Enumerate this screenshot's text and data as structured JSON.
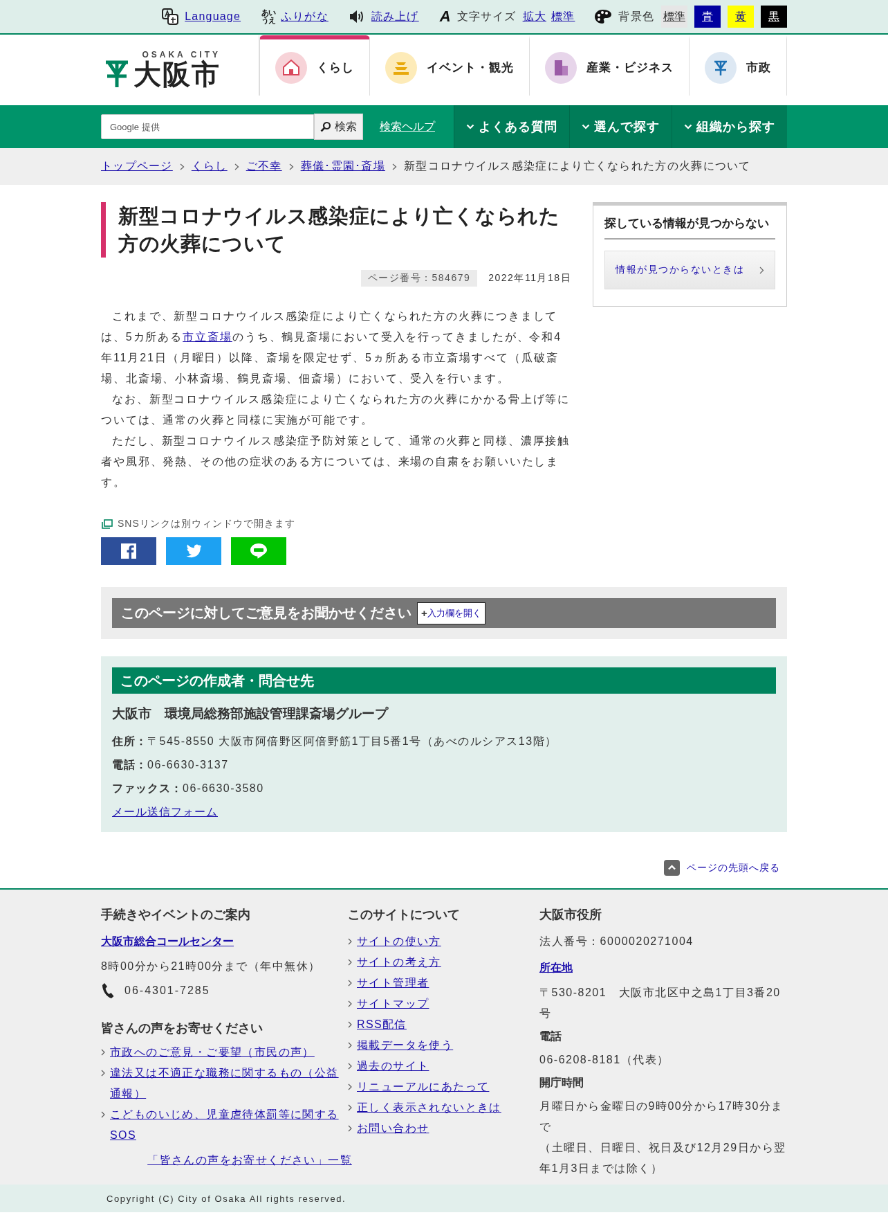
{
  "top_bar": {
    "language": "Language",
    "furigana_glyph": [
      "あい",
      "うえ"
    ],
    "furigana": "ふりがな",
    "read_aloud": "読み上げ",
    "font_size_glyph": "A",
    "font_size_label": "文字サイズ",
    "font_size_options": [
      "拡大",
      "標準"
    ],
    "background_label": "背景色",
    "background_options": [
      {
        "label": "標準",
        "color": "#e6e6e6"
      },
      {
        "label": "青",
        "color": "#0000a0"
      },
      {
        "label": "黄",
        "color": "#ffff00"
      },
      {
        "label": "黒",
        "color": "#000000"
      }
    ]
  },
  "header": {
    "logo_subtitle": "OSAKA CITY",
    "logo_name": "大阪市",
    "categories": [
      {
        "label": "くらし",
        "kind": "house",
        "color": "#f7d3d8",
        "selected": true
      },
      {
        "label": "イベント・観光",
        "kind": "castle",
        "color": "#fdebb8",
        "selected": false
      },
      {
        "label": "産業・ビジネス",
        "kind": "building",
        "color": "#e7d5ea",
        "selected": false
      },
      {
        "label": "市政",
        "kind": "emblem",
        "color": "#dde8f3",
        "selected": false
      }
    ]
  },
  "search": {
    "placeholder": "Google 提供",
    "button": "検索",
    "help": "検索ヘルプ"
  },
  "nav_menus": [
    "よくある質問",
    "選んで探す",
    "組織から探す"
  ],
  "breadcrumb": {
    "links": [
      "トップページ",
      "くらし",
      "ご不幸",
      "葬儀･霊園･斎場"
    ],
    "current": "新型コロナウイルス感染症により亡くなられた方の火葬について"
  },
  "article": {
    "title": "新型コロナウイルス感染症により亡くなられた方の火葬について",
    "page_number": "ページ番号：584679",
    "date": "2022年11月18日",
    "paragraphs": [
      [
        {
          "kind": "text",
          "text": "これまで、新型コロナウイルス感染症により亡くなられた方の火葬につきましては、5カ所ある"
        },
        {
          "kind": "link",
          "text": "市立斎場"
        },
        {
          "kind": "text",
          "text": "のうち、鶴見斎場において受入を行ってきましたが、令和4年11月21日（月曜日）以降、斎場を限定せず、5ヵ所ある市立斎場すべて（瓜破斎場、北斎場、小林斎場、鶴見斎場、佃斎場）において、受入を行います。"
        }
      ],
      [
        {
          "kind": "text",
          "text": "なお、新型コロナウイルス感染症により亡くなられた方の火葬にかかる骨上げ等については、通常の火葬と同様に実施が可能です。"
        }
      ],
      [
        {
          "kind": "text",
          "text": "ただし、新型コロナウイルス感染症予防対策として、通常の火葬と同様、濃厚接触者や風邪、発熱、その他の症状のある方については、来場の自粛をお願いいたします。"
        }
      ]
    ]
  },
  "sns": {
    "note": "SNSリンクは別ウィンドウで開きます",
    "buttons": [
      {
        "kind": "facebook"
      },
      {
        "kind": "twitter"
      },
      {
        "kind": "line"
      }
    ]
  },
  "opinion": {
    "title": "このページに対してご意見をお聞かせください",
    "button_sign": "+",
    "button_label": "入力欄を開く"
  },
  "contact": {
    "heading": "このページの作成者・問合せ先",
    "organization": "大阪市　環境局総務部施設管理課斎場グループ",
    "rows": [
      {
        "label": "住所：",
        "value": "〒545-8550 大阪市阿倍野区阿倍野筋1丁目5番1号（あべのルシアス13階）"
      },
      {
        "label": "電話：",
        "value": "06-6630-3137"
      },
      {
        "label": "ファックス：",
        "value": "06-6630-3580"
      }
    ],
    "mail_link": "メール送信フォーム"
  },
  "sidebar": {
    "heading": "探している情報が見つからない",
    "link": "情報が見つからないときは"
  },
  "page_top": "ページの先頭へ戻る",
  "footer": {
    "guide": {
      "heading": "手続きやイベントのご案内",
      "call_center": "大阪市総合コールセンター",
      "hours": "8時00分から21時00分まで（年中無休）",
      "phone": "06-4301-7285"
    },
    "voices": {
      "heading": "皆さんの声をお寄せください",
      "links": [
        "市政へのご意見・ご要望（市民の声）",
        "違法又は不適正な職務に関するもの（公益通報）",
        "こどものいじめ、児童虐待体罰等に関するSOS"
      ],
      "list_link": "「皆さんの声をお寄せください」一覧"
    },
    "about": {
      "heading": "このサイトについて",
      "links": [
        "サイトの使い方",
        "サイトの考え方",
        "サイト管理者",
        "サイトマップ",
        "RSS配信",
        "掲載データを使う",
        "過去のサイト",
        "リニューアルにあたって",
        "正しく表示されないときは",
        "お問い合わせ"
      ]
    },
    "office": {
      "heading": "大阪市役所",
      "corporate_number": "法人番号：6000020271004",
      "location_link": "所在地",
      "address": "〒530-8201　大阪市北区中之島1丁目3番20号",
      "phone_heading": "電話",
      "phone": "06-6208-8181（代表）",
      "hours_heading": "開庁時間",
      "hours": [
        "月曜日から金曜日の9時00分から17時30分まで",
        "（土曜日、日曜日、祝日及び12月29日から翌年1月3日までは除く）"
      ]
    }
  },
  "copyright": "Copyright (C) City of Osaka All rights reserved."
}
